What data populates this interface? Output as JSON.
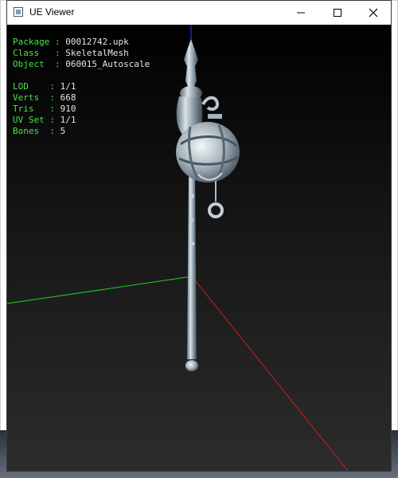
{
  "window": {
    "title": "UE Viewer"
  },
  "info": {
    "package_label": "Package",
    "package_value": "00012742.upk",
    "class_label": "Class",
    "class_value": "SkeletalMesh",
    "object_label": "Object",
    "object_value": "060015_Autoscale",
    "lod_label": "LOD",
    "lod_value": "1/1",
    "verts_label": "Verts",
    "verts_value": "668",
    "tris_label": "Tris",
    "tris_value": "910",
    "uvset_label": "UV Set",
    "uvset_value": "1/1",
    "bones_label": "Bones",
    "bones_value": "5"
  },
  "colors": {
    "label": "#47e547",
    "value": "#e6e6e6",
    "axis_x": "#d11a1a",
    "axis_y": "#1fd11f",
    "axis_z": "#2a3cff"
  }
}
